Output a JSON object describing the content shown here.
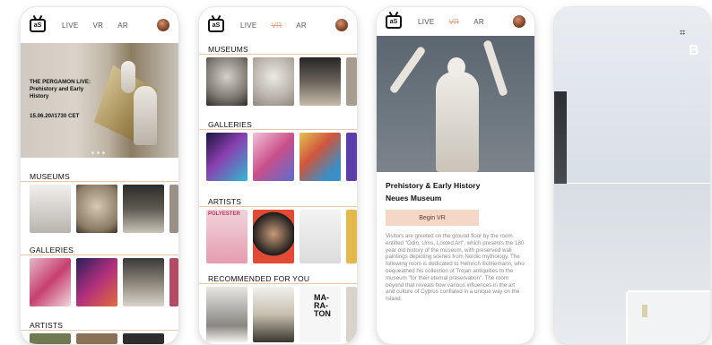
{
  "screens": [
    {
      "logo": "aS",
      "nav": [
        "LIVE",
        "VR",
        "AR"
      ],
      "hero": {
        "title": "THE PERGAMON LIVE: Prehistory and Early History",
        "date": "15.06.20//1730 CET"
      },
      "sections": [
        "MUSEUMS",
        "GALLERIES",
        "ARTISTS"
      ]
    },
    {
      "logo": "aS",
      "nav": [
        "LIVE",
        "VR",
        "AR"
      ],
      "active_nav": "VR",
      "sections": [
        "MUSEUMS",
        "GALLERIES",
        "ARTISTS",
        "RECOMMENDED FOR YOU"
      ],
      "poster_text": "POLYESTER",
      "art_text": [
        "MA-",
        "RA-",
        "TON"
      ]
    },
    {
      "logo": "aS",
      "nav": [
        "LIVE",
        "VR",
        "AR"
      ],
      "active_nav": "VR",
      "title_line1": "Prehistory & Early History",
      "title_line2": "Neues Museum",
      "button": "Begin VR",
      "description": "Visitors are greeted on the ground floor by the room entitled \"Odin, Urns, Looted Art\", which presents the 180 year old history of the museum, with preserved wall paintings depicting scenes from Nordic mythology. The following room is dedicated to Heinrich Schliemann, who bequeathed his collection of Trojan antiquities to the museum \"for their eternal preservation\". The room beyond that reveals how various influences in the art and culture of Cyprus conflated in a unique way on the Island."
    },
    {
      "icon_a": "cube-outline-icon",
      "icon_b": "B"
    }
  ],
  "colors": {
    "accent": "#e0a27c",
    "button_bg": "#f4d8c5"
  }
}
